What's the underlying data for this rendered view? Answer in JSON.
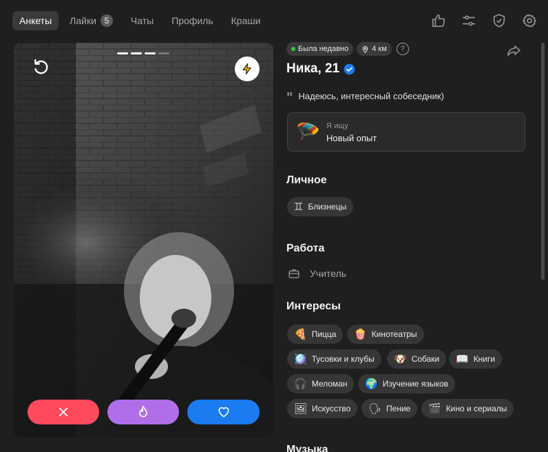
{
  "tabs": [
    {
      "label": "Анкеты",
      "active": true
    },
    {
      "label": "Лайки",
      "badge": "5"
    },
    {
      "label": "Чаты"
    },
    {
      "label": "Профиль"
    },
    {
      "label": "Краши"
    }
  ],
  "top_icons": [
    "thumbs-up-icon",
    "sliders-icon",
    "shield-check-icon",
    "gear-icon"
  ],
  "profile": {
    "status": "Была недавно",
    "distance": "4 км",
    "help": "?",
    "name": "Ника, 21",
    "quote": "Надеюсь, интересный собеседник)",
    "seeking": {
      "label": "Я ищу",
      "value": "Новый опыт",
      "emoji": "🪂"
    }
  },
  "sections": {
    "personal": "Личное",
    "work": "Работа",
    "interests": "Интересы",
    "music": "Музыка"
  },
  "personal_tags": [
    {
      "icon": "♊",
      "label": "Близнецы"
    }
  ],
  "work_value": "Учитель",
  "interests": [
    {
      "emoji": "🍕",
      "label": "Пицца"
    },
    {
      "emoji": "🍿",
      "label": "Кинотеатры"
    },
    {
      "emoji": "🪩",
      "label": "Тусовки и клубы"
    },
    {
      "emoji": "🐶",
      "label": "Собаки"
    },
    {
      "emoji": "📖",
      "label": "Книги"
    },
    {
      "emoji": "🎧",
      "label": "Меломан"
    },
    {
      "emoji": "🌍",
      "label": "Изучение языков"
    },
    {
      "emoji": "🖼",
      "label": "Искусство"
    },
    {
      "emoji": "🗣",
      "label": "Пение"
    },
    {
      "emoji": "🎬",
      "label": "Кино и сериалы"
    }
  ],
  "photo": {
    "count": 4,
    "current": 3
  },
  "colors": {
    "dislike": "#ff4a5d",
    "superlike": "#b06ee9",
    "like": "#1a7cf0",
    "online": "#2ecc40",
    "verified": "#1a7cf0"
  }
}
